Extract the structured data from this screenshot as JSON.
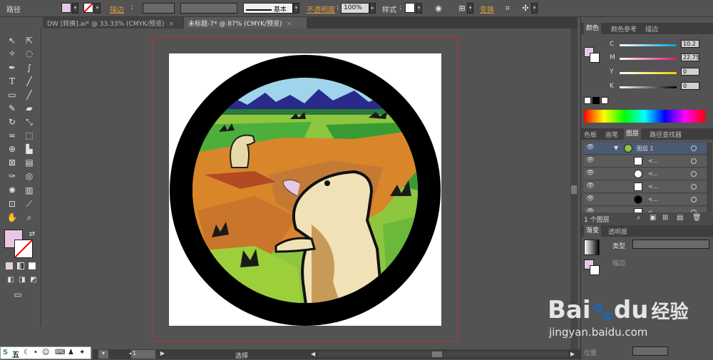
{
  "control_bar": {
    "path_label": "路径",
    "stroke_label": "描边",
    "brush_label": "基本",
    "opacity_label": "不透明度",
    "opacity_value": "100%",
    "style_label": "样式",
    "transform_label": "变换"
  },
  "tabs": [
    {
      "label": "DW [转换].ai* @ 33.33% (CMYK/预览)",
      "close": "×"
    },
    {
      "label": "未标题-7* @ 87% (CMYK/预览)",
      "close": "×"
    }
  ],
  "color_panel": {
    "tabs": [
      "颜色",
      "颜色参考",
      "描边"
    ],
    "channels": [
      {
        "name": "C",
        "value": "10.2"
      },
      {
        "name": "M",
        "value": "22.75"
      },
      {
        "name": "Y",
        "value": "0"
      },
      {
        "name": "K",
        "value": "0"
      }
    ],
    "swatch_color": "#e8c7e4"
  },
  "layers_panel": {
    "tabs": [
      "色板",
      "画笔",
      "图层",
      "路径查找器"
    ],
    "layer_name": "图层 1",
    "sublayer_label": "<...",
    "footer_count": "1 个图层"
  },
  "gradient_panel": {
    "tabs": [
      "渐变",
      "透明度"
    ],
    "type_label": "类型",
    "stroke_label": "描边",
    "position_label": "位置"
  },
  "status": {
    "zoom": "87%",
    "page": "1",
    "tool_label": "选择"
  },
  "ime": {
    "label": "五"
  },
  "watermark": {
    "brand": "Bai",
    "brand2": "du",
    "product": "经验",
    "url": "jingyan.baidu.com"
  },
  "colors": {
    "fill_swatch": "#e8c7e4",
    "ui_bg": "#535353",
    "accent_orange": "#e09a3c"
  }
}
